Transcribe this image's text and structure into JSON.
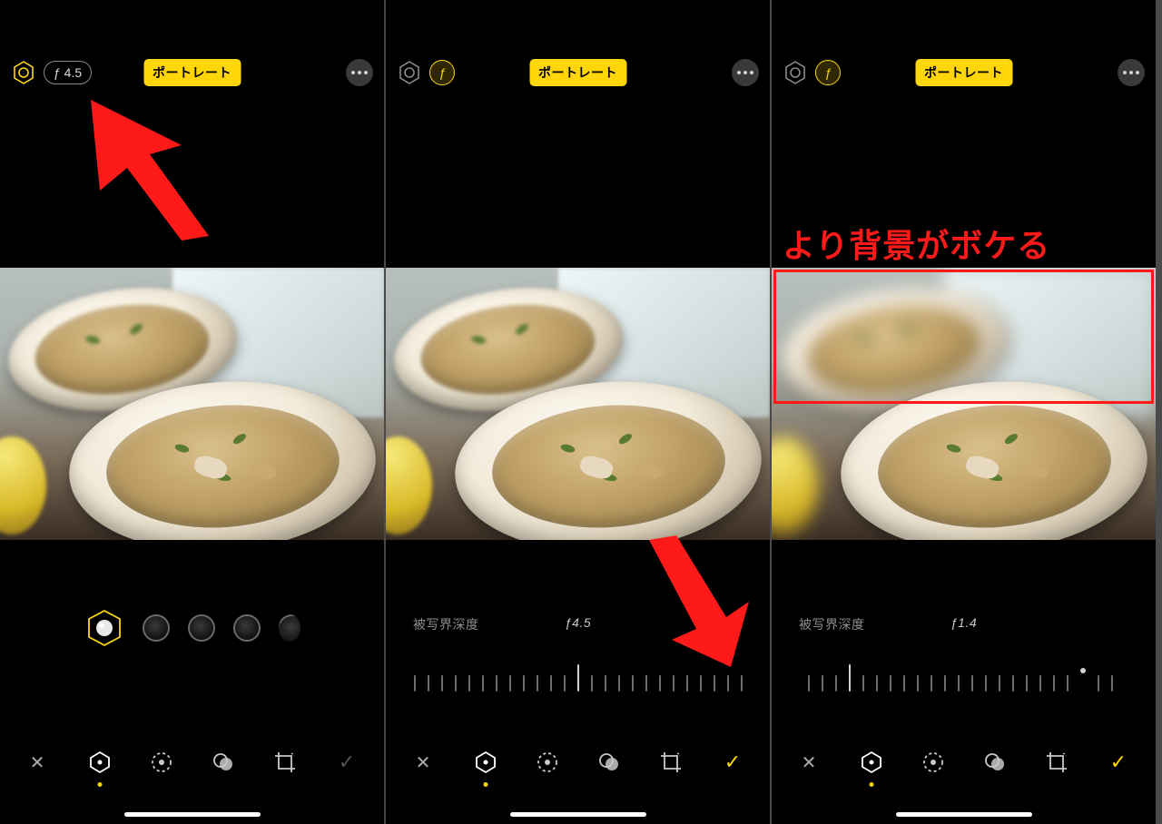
{
  "mode_label": "ポートレート",
  "annotation_text": "より背景がボケる",
  "panel1": {
    "f_value": "ƒ 4.5",
    "hex_active": true
  },
  "panel2": {
    "depth_label": "被写界深度",
    "depth_value": "ƒ4.5"
  },
  "panel3": {
    "depth_label": "被写界深度",
    "depth_value": "ƒ1.4"
  },
  "icons": {
    "cancel": "✕",
    "done": "✓"
  }
}
